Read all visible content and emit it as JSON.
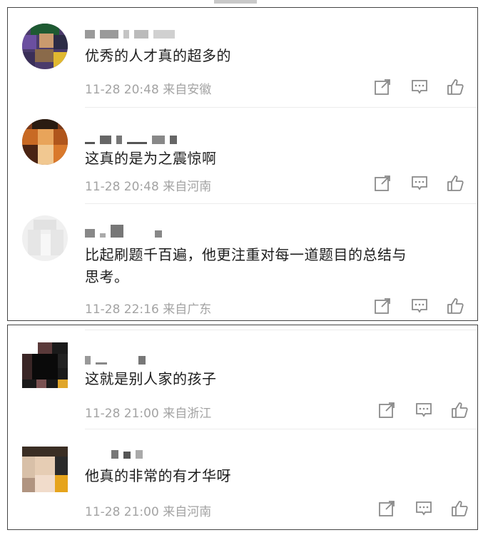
{
  "comments": [
    {
      "text": "优秀的人才真的超多的",
      "time": "11-28 20:48",
      "location": "来自安徽"
    },
    {
      "text": "这真的是为之震惊啊",
      "time": "11-28 20:48",
      "location": "来自河南"
    },
    {
      "text_line1": "比起刷题千百遍，他更注重对每一道题目的总结与",
      "text_line2": "思考。",
      "time": "11-28 22:16",
      "location": "来自广东"
    },
    {
      "text": "这就是别人家的孩子",
      "time": "11-28 21:00",
      "location": "来自浙江"
    },
    {
      "text": "他真的非常的有才华呀",
      "time": "11-28 21:00",
      "location": "来自河南"
    }
  ],
  "icons": {
    "share": "share-icon",
    "reply": "reply-icon",
    "like": "like-icon"
  },
  "colors": {
    "meta": "#a3a3a3",
    "icon": "#8a8a8a",
    "text": "#1c1c1c"
  }
}
